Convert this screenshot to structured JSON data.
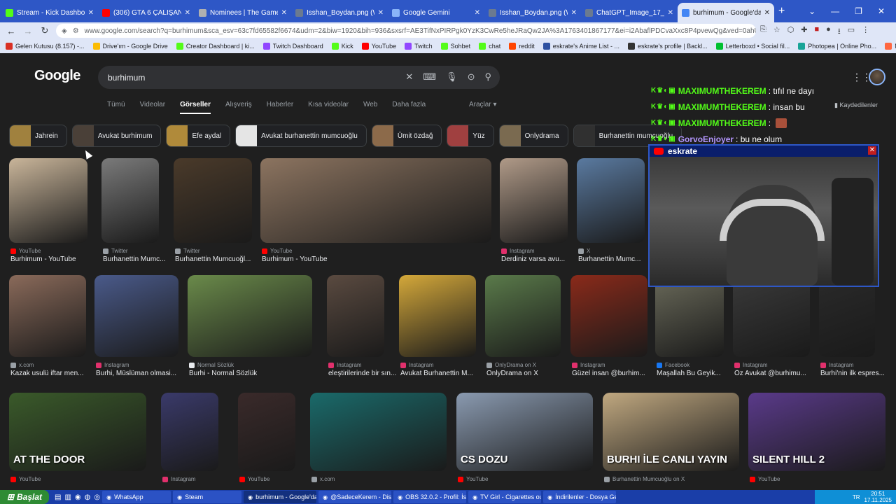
{
  "tabs": [
    {
      "title": "Stream - Kick Dashboard",
      "color": "#53fc18"
    },
    {
      "title": "(306) GTA 6 ÇALIŞANLAR VE",
      "color": "#ff0000"
    },
    {
      "title": "Nominees | The Game Awar",
      "color": "#b0b0b0"
    },
    {
      "title": "Isshan_Boydan.png (WEBP resm",
      "color": "#6b7a90"
    },
    {
      "title": "Google Gemini",
      "color": "#8ab4f8"
    },
    {
      "title": "Isshan_Boydan.png (WEBP resmi",
      "color": "#6b7a90"
    },
    {
      "title": "ChatGPT_Image_17_Kas_2025_2",
      "color": "#6b7a90"
    },
    {
      "title": "burhimum - Google'da Ara",
      "color": "#4285f4"
    }
  ],
  "url": "www.google.com/search?q=burhimum&sca_esv=63c7fd65582f6674&udm=2&biw=1920&bih=936&sxsrf=AE3TifNxPIRPgk0YzK3CwRe5heJRaQw2JA%3A1763401867177&ei=i2AbaflPDCvaXxc8P4pvewQg&ved=0ahUKEwiztY7v",
  "bookmarks": [
    {
      "label": "Gelen Kutusu (8.157) -...",
      "color": "#d93025"
    },
    {
      "label": "Drive'ım - Google Drive",
      "color": "#fbbc04"
    },
    {
      "label": "Creator Dashboard | ki...",
      "color": "#53fc18"
    },
    {
      "label": "Twitch Dashboard",
      "color": "#9146ff"
    },
    {
      "label": "Kick",
      "color": "#53fc18"
    },
    {
      "label": "YouTube",
      "color": "#ff0000"
    },
    {
      "label": "Twitch",
      "color": "#9146ff"
    },
    {
      "label": "Sohbet",
      "color": "#53fc18"
    },
    {
      "label": "chat",
      "color": "#53fc18"
    },
    {
      "label": "reddit",
      "color": "#ff4500"
    },
    {
      "label": "eskrate's Anime List - ...",
      "color": "#2e51a2"
    },
    {
      "label": "eskrate's profile | Backl...",
      "color": "#333333"
    },
    {
      "label": "Letterboxd • Social fil...",
      "color": "#00c030"
    },
    {
      "label": "Photopea | Online Pho...",
      "color": "#18a497"
    },
    {
      "label": "MangaDex - High qua...",
      "color": "#ff6740"
    },
    {
      "label": "Aternos",
      "color": "#333333"
    }
  ],
  "search": {
    "query": "burhimum"
  },
  "verticals": [
    "Tümü",
    "Videolar",
    "Görseller",
    "Alışveriş",
    "Haberler",
    "Kısa videolar",
    "Web",
    "Daha fazla"
  ],
  "tools_label": "Araçlar",
  "chips": [
    {
      "label": "Jahrein",
      "color": "#a0813e"
    },
    {
      "label": "Avukat burhimum",
      "color": "#4a4038"
    },
    {
      "label": "Efe aydal",
      "color": "#b08a3a"
    },
    {
      "label": "Avukat burhanettin mumcuoğlu",
      "color": "#e5e5e5"
    },
    {
      "label": "Ümit özdağ",
      "color": "#8c6a4a"
    },
    {
      "label": "Yüz",
      "color": "#a04040"
    },
    {
      "label": "Onlydrama",
      "color": "#7a6a50"
    },
    {
      "label": "Burhanettin mumcuoğlu",
      "color": "#303030"
    }
  ],
  "results_row1": [
    {
      "source": "YouTube",
      "title": "Burhimum - YouTube",
      "color": "#c9b59a",
      "src_color": "#ff0000"
    },
    {
      "source": "Twitter",
      "title": "Burhanettin Mumc...",
      "color": "#7a7a7a",
      "src_color": "#9aa0a6"
    },
    {
      "source": "Twitter",
      "title": "Burhanettin Mumcuoğl...",
      "color": "#4a3a2a",
      "src_color": "#9aa0a6"
    },
    {
      "source": "YouTube",
      "title": "Burhimum - YouTube",
      "color": "#8c7460",
      "src_color": "#ff0000"
    },
    {
      "source": "Instagram",
      "title": "Derdiniz varsa avu...",
      "color": "#b09a88",
      "src_color": "#e1306c"
    },
    {
      "source": "X",
      "title": "Burhanettin Mumc...",
      "color": "#5a7aa0",
      "src_color": "#9aa0a6"
    }
  ],
  "results_row2": [
    {
      "source": "x.com",
      "title": "Kazak usulü iftar men...",
      "color": "#8a6a5a",
      "src_color": "#9aa0a6"
    },
    {
      "source": "Instagram",
      "title": "Burhi, Müslüman olmasi...",
      "color": "#4a5a8a",
      "src_color": "#e1306c"
    },
    {
      "source": "Normal Sözlük",
      "title": "Burhi - Normal Sözlük",
      "color": "#6a8a4a",
      "src_color": "#e8eaed"
    },
    {
      "source": "Instagram",
      "title": "eleştirilerinde bir sın...",
      "color": "#5a4a40",
      "src_color": "#e1306c"
    },
    {
      "source": "Instagram",
      "title": "Avukat Burhanettin M...",
      "color": "#d4a83a",
      "src_color": "#e1306c"
    },
    {
      "source": "OnlyDrama on X",
      "title": "OnlyDrama on X",
      "color": "#5a7a4a",
      "src_color": "#9aa0a6"
    },
    {
      "source": "Instagram",
      "title": "Güzel insan @burhim...",
      "color": "#8a2a1a",
      "src_color": "#e1306c"
    },
    {
      "source": "Facebook",
      "title": "Maşallah Bu Geyik...",
      "color": "#6a6a5a",
      "src_color": "#1877f2"
    },
    {
      "source": "Instagram",
      "title": "Öz Avukat @burhimu...",
      "color": "#3a3a3a",
      "src_color": "#e1306c"
    },
    {
      "source": "Instagram",
      "title": "Burhi'nin ilk espres...",
      "color": "#2a2a2a",
      "src_color": "#e1306c"
    }
  ],
  "results_row3": [
    {
      "source": "YouTube",
      "overlay": "AT THE DOOR",
      "color": "#3a5a2a",
      "src_color": "#ff0000"
    },
    {
      "source": "Instagram",
      "overlay": "",
      "color": "#3a3a6a",
      "src_color": "#e1306c"
    },
    {
      "source": "YouTube",
      "overlay": "",
      "color": "#3a2a2a",
      "src_color": "#ff0000"
    },
    {
      "source": "x.com",
      "overlay": "",
      "color": "#1a6a6a",
      "src_color": "#9aa0a6"
    },
    {
      "source": "YouTube",
      "overlay": "CS DOZU",
      "color": "#8a9ab0",
      "src_color": "#ff0000"
    },
    {
      "source": "Burhanettin Mumcuoğlu on X",
      "overlay": "BURHI İLE CANLI YAYIN",
      "color": "#c0a880",
      "src_color": "#9aa0a6"
    },
    {
      "source": "YouTube",
      "overlay": "SILENT HILL 2",
      "color": "#5a3a8a",
      "src_color": "#ff0000"
    }
  ],
  "chat": [
    {
      "user": "MAXIMUMTHEKEREM",
      "msg": ": tıfıl ne dayı"
    },
    {
      "user": "MAXIMUMTHEKEREM",
      "msg": ": insan bu"
    },
    {
      "user": "MAXIMUMTHEKEREM",
      "msg": ":"
    },
    {
      "user": "GorvoEnjoyer",
      "msg": ": bu ne olum"
    }
  ],
  "saved_label": "Kaydedilenler",
  "webcam": {
    "title": "eskrate",
    "close": "✕"
  },
  "taskbar": {
    "start": "Başlat",
    "items": [
      "WhatsApp",
      "Steam",
      "burhimum - Google'da...",
      "@SadeceKerem - Disco...",
      "OBS 32.0.2 - Profil: İsi...",
      "TV Girl - Cigarettes out...",
      "İndirilenler - Dosya Ge..."
    ],
    "tray_lang": "TR",
    "time": "20:51",
    "date": "17.11.2025"
  }
}
